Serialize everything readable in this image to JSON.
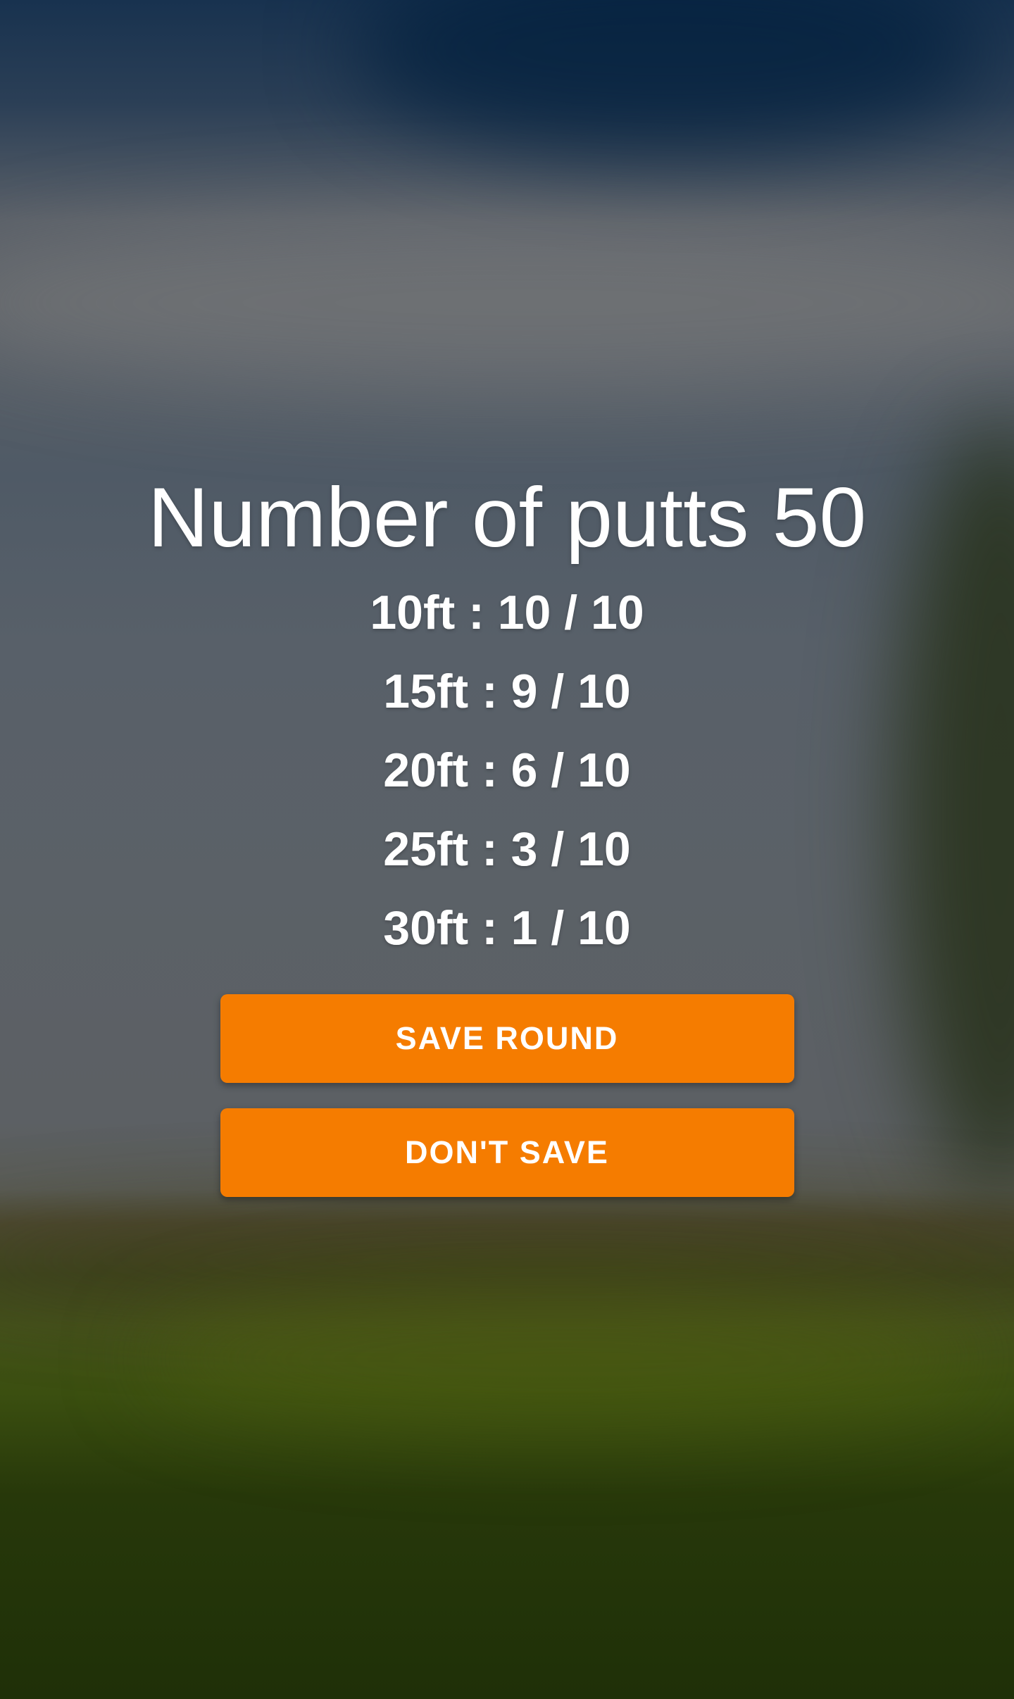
{
  "summary": {
    "title": "Number of putts 50",
    "rows": [
      "10ft : 10 / 10",
      "15ft : 9 / 10",
      "20ft : 6 / 10",
      "25ft : 3 / 10",
      "30ft : 1 / 10"
    ]
  },
  "actions": {
    "save_label": "SAVE ROUND",
    "dont_save_label": "DON'T SAVE"
  },
  "colors": {
    "accent": "#f57c00",
    "text": "#ffffff"
  }
}
